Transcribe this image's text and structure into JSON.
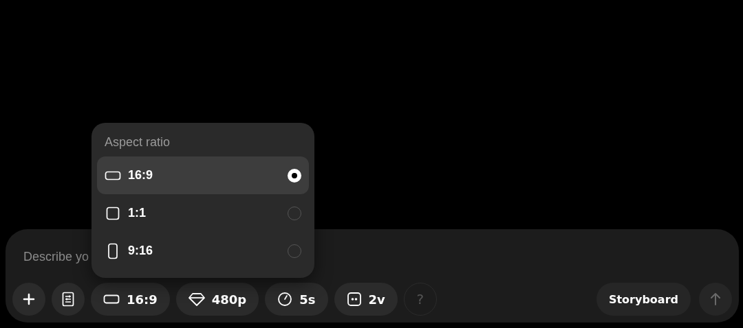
{
  "composer": {
    "placeholder": "Describe yo",
    "toolbar": [
      {
        "kind": "plus"
      },
      {
        "kind": "settings"
      },
      {
        "kind": "ratio",
        "label": "16:9"
      },
      {
        "kind": "quality",
        "label": "480p"
      },
      {
        "kind": "duration",
        "label": "5s"
      },
      {
        "kind": "variations",
        "label": "2v"
      },
      {
        "kind": "help",
        "label": "?",
        "disabled": true
      }
    ],
    "actions": [
      {
        "kind": "text",
        "label": "Storyboard"
      },
      {
        "kind": "submit",
        "disabled": true
      }
    ]
  },
  "menu": {
    "title": "Aspect ratio",
    "options": [
      {
        "kind": "wide",
        "label": "16:9",
        "selected": true
      },
      {
        "kind": "square",
        "label": "1:1",
        "selected": false
      },
      {
        "kind": "tall",
        "label": "9:16",
        "selected": false
      }
    ]
  }
}
